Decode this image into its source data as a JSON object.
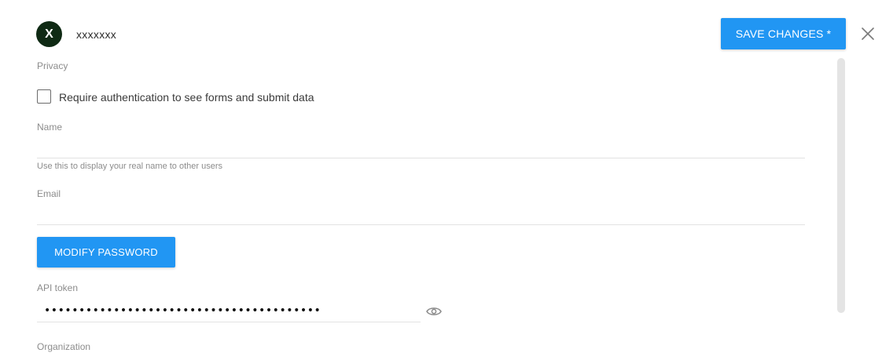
{
  "header": {
    "avatar_initial": "X",
    "username": "xxxxxxx",
    "save_label": "SAVE CHANGES *"
  },
  "privacy": {
    "section_label": "Privacy",
    "checkbox_label": "Require authentication to see forms and submit data",
    "checked": false
  },
  "name_field": {
    "label": "Name",
    "value": "",
    "hint": "Use this to display your real name to other users"
  },
  "email_field": {
    "label": "Email",
    "value": ""
  },
  "modify_password_label": "MODIFY PASSWORD",
  "api_token": {
    "label": "API token",
    "masked_value": "••••••••••••••••••••••••••••••••••••••••"
  },
  "organization": {
    "label": "Organization"
  },
  "icons": {
    "close": "close-icon",
    "reveal": "eye-icon"
  },
  "colors": {
    "primary": "#2196f3",
    "avatar_bg": "#0f2a14"
  }
}
